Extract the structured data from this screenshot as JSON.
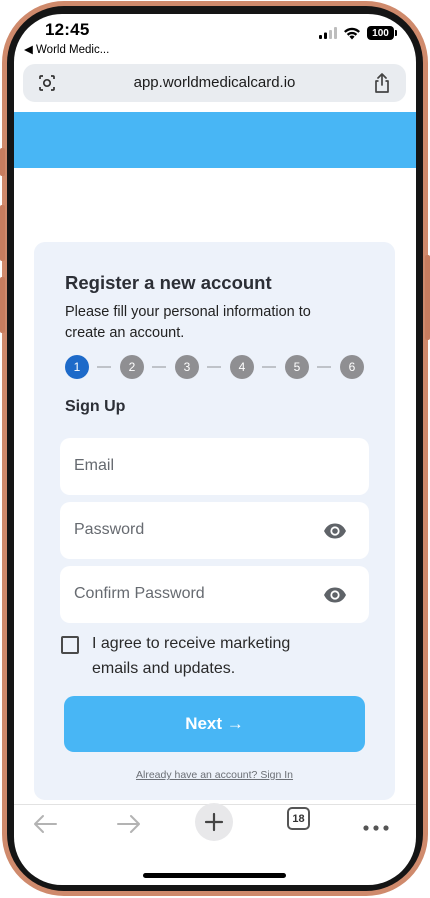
{
  "status_bar": {
    "time": "12:45",
    "back_label": "◀ World Medic...",
    "battery": "100",
    "icons": [
      "signal-icon",
      "wifi-icon",
      "battery-icon"
    ]
  },
  "browser": {
    "url": "app.worldmedicalcard.io",
    "tab_count": "18",
    "icons": [
      "camera-search-icon",
      "share-icon",
      "back-arrow-icon",
      "forward-arrow-icon",
      "plus-icon",
      "tabs-icon",
      "more-icon"
    ]
  },
  "form": {
    "title": "Register a new account",
    "subtitle": "Please fill your personal information to create an account.",
    "steps": [
      "1",
      "2",
      "3",
      "4",
      "5",
      "6"
    ],
    "active_step": 1,
    "section_label": "Sign Up",
    "email_placeholder": "Email",
    "password_placeholder": "Password",
    "confirm_password_placeholder": "Confirm Password",
    "agree_text": "I agree to receive marketing emails and updates.",
    "agree_checked": false,
    "next_button": "Next →",
    "signin_link": "Already have an account? Sign In"
  },
  "colors": {
    "accent": "#48b6f5",
    "active_step": "#1d6ac9",
    "inactive_step": "#8f8f92",
    "card_bg": "#edf2fa",
    "frame": "#cf8a6c"
  }
}
